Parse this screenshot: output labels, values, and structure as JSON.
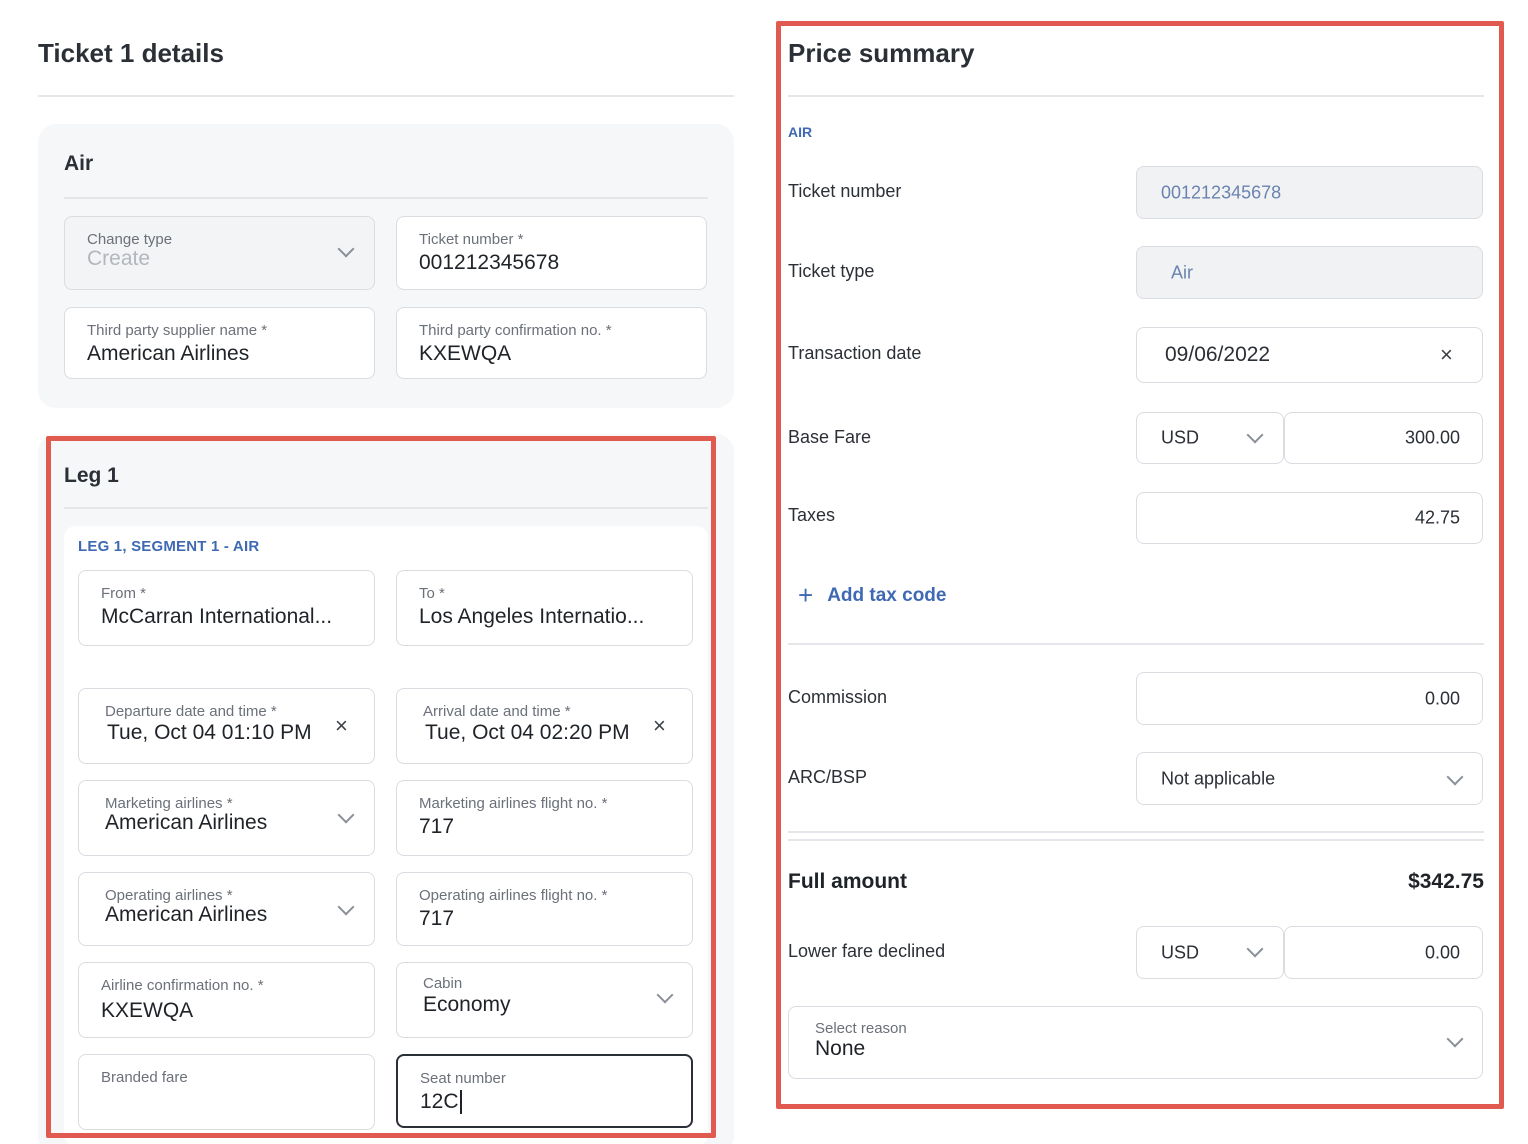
{
  "ticket_details": {
    "title": "Ticket 1 details",
    "air_section": {
      "title": "Air",
      "change_type": {
        "label": "Change type",
        "value": "Create"
      },
      "ticket_number": {
        "label": "Ticket number *",
        "value": "001212345678"
      },
      "supplier_name": {
        "label": "Third party supplier name *",
        "value": "American Airlines"
      },
      "confirmation_no": {
        "label": "Third party confirmation no. *",
        "value": "KXEWQA"
      }
    },
    "leg": {
      "title": "Leg 1",
      "segment_label": "LEG 1, SEGMENT 1 - AIR",
      "from": {
        "label": "From *",
        "value": "McCarran International..."
      },
      "to": {
        "label": "To *",
        "value": "Los Angeles Internatio..."
      },
      "departure": {
        "label": "Departure date and time *",
        "value": "Tue, Oct 04 01:10 PM"
      },
      "arrival": {
        "label": "Arrival date and time *",
        "value": "Tue, Oct 04 02:20 PM"
      },
      "marketing_airline": {
        "label": "Marketing airlines *",
        "value": "American Airlines"
      },
      "marketing_flight": {
        "label": "Marketing airlines flight no. *",
        "value": "717"
      },
      "operating_airline": {
        "label": "Operating airlines *",
        "value": "American Airlines"
      },
      "operating_flight": {
        "label": "Operating airlines flight no. *",
        "value": "717"
      },
      "airline_confirmation": {
        "label": "Airline confirmation no. *",
        "value": "KXEWQA"
      },
      "cabin": {
        "label": "Cabin",
        "value": "Economy"
      },
      "branded_fare": {
        "label": "Branded fare",
        "value": ""
      },
      "seat_number": {
        "label": "Seat number",
        "value": "12C"
      }
    }
  },
  "price_summary": {
    "title": "Price summary",
    "air_tag": "AIR",
    "ticket_number": {
      "label": "Ticket number",
      "value": "001212345678"
    },
    "ticket_type": {
      "label": "Ticket type",
      "value": "Air"
    },
    "transaction_date": {
      "label": "Transaction date",
      "value": "09/06/2022"
    },
    "base_fare": {
      "label": "Base Fare",
      "currency": "USD",
      "value": "300.00"
    },
    "taxes": {
      "label": "Taxes",
      "value": "42.75"
    },
    "add_tax_code": "Add tax code",
    "commission": {
      "label": "Commission",
      "value": "0.00"
    },
    "arc_bsp": {
      "label": "ARC/BSP",
      "value": "Not applicable"
    },
    "full_amount": {
      "label": "Full amount",
      "value": "$342.75"
    },
    "lower_fare_declined": {
      "label": "Lower fare declined",
      "currency": "USD",
      "value": "0.00"
    },
    "select_reason": {
      "label": "Select reason",
      "value": "None"
    }
  },
  "colors": {
    "highlight_border": "#e05a4f",
    "accent_blue": "#3f6ab3"
  }
}
